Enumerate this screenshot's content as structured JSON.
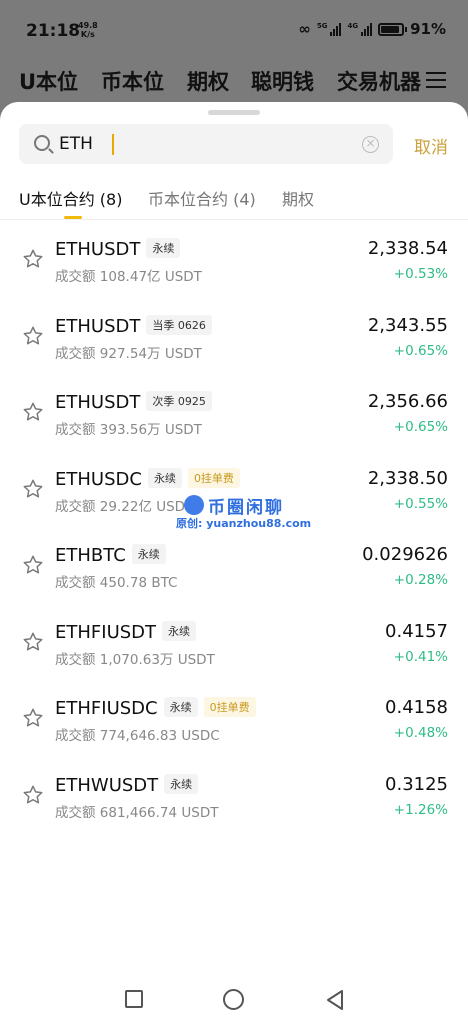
{
  "status": {
    "time": "21:18",
    "speed_value": "49.8",
    "speed_unit": "K/s",
    "sig1_label": "5G",
    "sig2_label": "4G",
    "battery": "91%"
  },
  "background_tabs": [
    "U本位",
    "币本位",
    "期权",
    "聪明钱",
    "交易机器"
  ],
  "search": {
    "value": "ETH",
    "cancel_label": "取消"
  },
  "tabs": [
    {
      "label": "U本位合约 (8)",
      "active": true
    },
    {
      "label": "币本位合约 (4)",
      "active": false
    },
    {
      "label": "期权",
      "active": false
    }
  ],
  "items": [
    {
      "symbol": "ETHUSDT",
      "tag": "永续",
      "fee": "",
      "volume": "成交额 108.47亿 USDT",
      "price": "2,338.54",
      "change": "+0.53%"
    },
    {
      "symbol": "ETHUSDT",
      "tag": "当季 0626",
      "fee": "",
      "volume": "成交额 927.54万 USDT",
      "price": "2,343.55",
      "change": "+0.65%"
    },
    {
      "symbol": "ETHUSDT",
      "tag": "次季 0925",
      "fee": "",
      "volume": "成交额 393.56万 USDT",
      "price": "2,356.66",
      "change": "+0.65%"
    },
    {
      "symbol": "ETHUSDC",
      "tag": "永续",
      "fee": "0挂单费",
      "volume": "成交额 29.22亿 USDC",
      "price": "2,338.50",
      "change": "+0.55%"
    },
    {
      "symbol": "ETHBTC",
      "tag": "永续",
      "fee": "",
      "volume": "成交额 450.78 BTC",
      "price": "0.029626",
      "change": "+0.28%"
    },
    {
      "symbol": "ETHFIUSDT",
      "tag": "永续",
      "fee": "",
      "volume": "成交额 1,070.63万 USDT",
      "price": "0.4157",
      "change": "+0.41%"
    },
    {
      "symbol": "ETHFIUSDC",
      "tag": "永续",
      "fee": "0挂单费",
      "volume": "成交额 774,646.83 USDC",
      "price": "0.4158",
      "change": "+0.48%"
    },
    {
      "symbol": "ETHWUSDT",
      "tag": "永续",
      "fee": "",
      "volume": "成交额 681,466.74 USDT",
      "price": "0.3125",
      "change": "+1.26%"
    }
  ],
  "watermark": {
    "title": "币圈闲聊",
    "subtitle": "原创: yuanzhou88.com"
  },
  "colors": {
    "accent": "#f0b90b",
    "cancel": "#caa13a",
    "up": "#2fbd85",
    "fee_text": "#c89a1e"
  },
  "icons": {
    "search": "search-icon",
    "clear": "clear-icon",
    "favorite": "star-icon",
    "menu": "menu-icon"
  }
}
